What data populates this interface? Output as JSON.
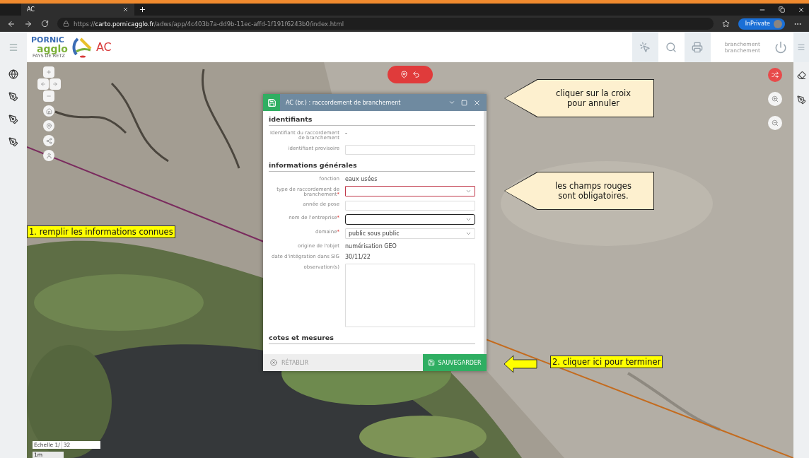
{
  "browser": {
    "tab_title": "AC",
    "url_prefix": "https://",
    "url_host": "carto.pornicagglo.fr",
    "url_path": "/adws/app/4c403b7a-dd9b-11ec-affd-1f191f6243b0/index.html",
    "profile_label": "InPrivate"
  },
  "app_header": {
    "logo": {
      "line1": "PORNiC",
      "line2": "agglo",
      "line3": "PAYS DE RETZ"
    },
    "title": "AC",
    "user_lines": [
      "branchement",
      "branchement"
    ]
  },
  "map": {
    "scale_label": "Echelle 1/",
    "scale_value": "32",
    "scale_bar": "1m"
  },
  "dialog": {
    "title": "AC (br.) : raccordement de branchement",
    "required_mark": "*",
    "sections": [
      {
        "title": "identifiants",
        "fields": [
          {
            "label": "Identifiant du raccordement de branchement",
            "kind": "static",
            "value": "-",
            "required": false
          },
          {
            "label": "identifiant provisoire",
            "kind": "input",
            "required": false,
            "invalid": false,
            "focused": false
          }
        ]
      },
      {
        "title": "informations générales",
        "fields": [
          {
            "label": "fonction",
            "kind": "static",
            "value": "eaux usées",
            "required": false
          },
          {
            "label": "type de raccordement de branchement",
            "kind": "select",
            "required": true,
            "invalid": true,
            "focused": false
          },
          {
            "label": "année de pose",
            "kind": "input",
            "required": false,
            "invalid": false,
            "focused": false
          },
          {
            "label": "nom de l'entreprise",
            "kind": "select",
            "required": true,
            "invalid": false,
            "focused": true
          },
          {
            "label": "domaine",
            "kind": "select",
            "value": "public sous public",
            "required": true,
            "invalid": false,
            "focused": false
          },
          {
            "label": "origine de l'objet",
            "kind": "static",
            "value": "numérisation GEO",
            "required": false
          },
          {
            "label": "date d'intégration dans SIG",
            "kind": "static",
            "value": "30/11/22",
            "required": false
          },
          {
            "label": "observation(s)",
            "kind": "textarea",
            "required": false,
            "invalid": false,
            "focused": false
          }
        ]
      },
      {
        "title": "cotes et mesures"
      }
    ],
    "reset_label": "RÉTABLIR",
    "save_label": "SAUVEGARDER"
  },
  "annotations": [
    {
      "kind": "callout",
      "text": "cliquer sur la croix pour annuler"
    },
    {
      "kind": "callout",
      "text": "les champs rouges sont obligatoires."
    },
    {
      "kind": "highlight",
      "text": "1. remplir les informations connues"
    },
    {
      "kind": "arrow_highlight",
      "text": "2. cliquer ici pour terminer"
    }
  ]
}
